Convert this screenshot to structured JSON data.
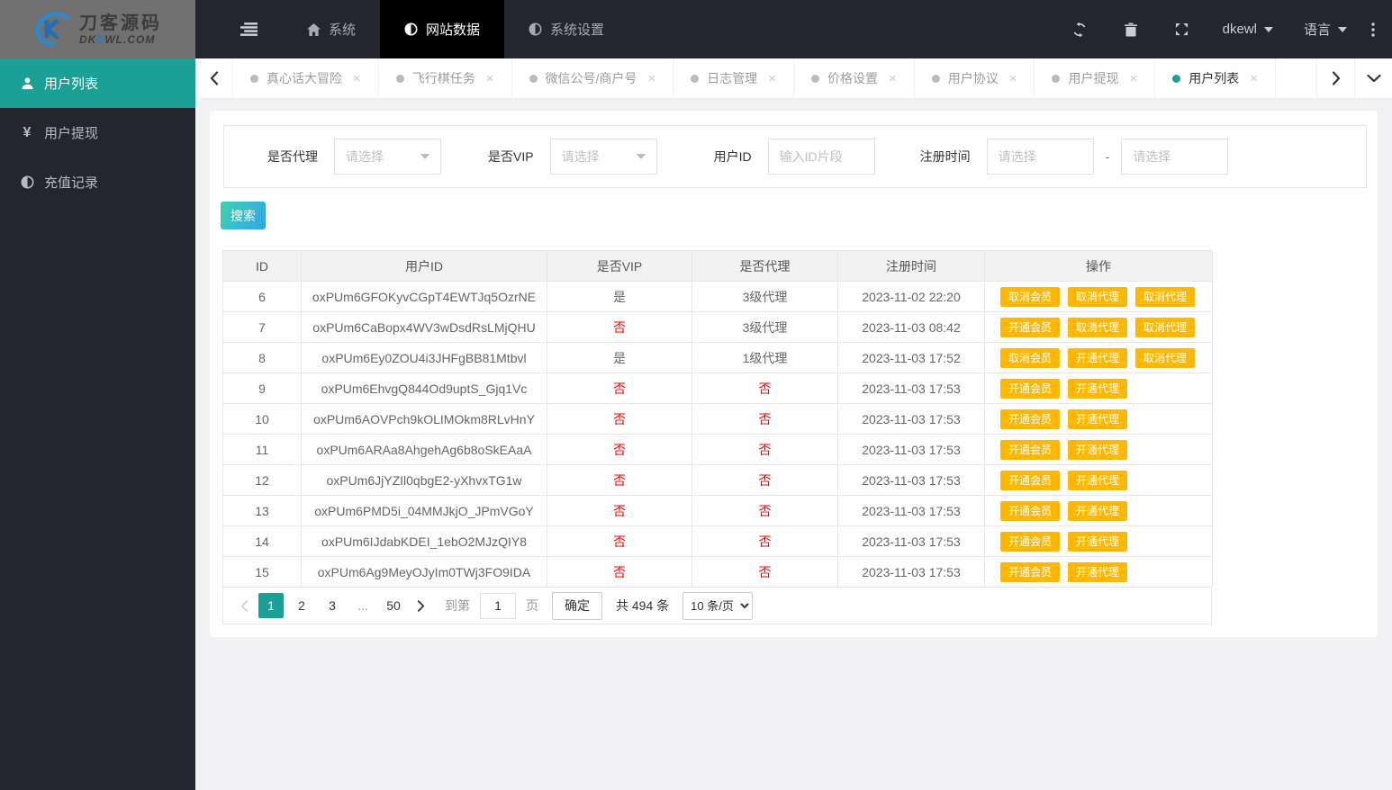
{
  "brand": {
    "title": "刀客源码",
    "sub_dk": "DK",
    "sub_e": "E",
    "sub_wl": "WL.COM"
  },
  "topnav": {
    "items": [
      {
        "label": "系统",
        "icon": "home-icon",
        "active": false
      },
      {
        "label": "网站数据",
        "icon": "half-circle-icon",
        "active": true
      },
      {
        "label": "系统设置",
        "icon": "half-circle-icon",
        "active": false
      }
    ],
    "user_label": "dkewl",
    "language_label": "语言"
  },
  "sidebar": {
    "items": [
      {
        "label": "用户列表",
        "icon": "user-icon",
        "active": true
      },
      {
        "label": "用户提现",
        "icon": "yen-icon",
        "active": false
      },
      {
        "label": "充值记录",
        "icon": "half-circle-icon",
        "active": false
      }
    ]
  },
  "tabbar": {
    "tabs": [
      {
        "label": "真心话大冒险",
        "active": false
      },
      {
        "label": "飞行棋任务",
        "active": false
      },
      {
        "label": "微信公号/商户号",
        "active": false
      },
      {
        "label": "日志管理",
        "active": false
      },
      {
        "label": "价格设置",
        "active": false
      },
      {
        "label": "用户协议",
        "active": false
      },
      {
        "label": "用户提现",
        "active": false
      },
      {
        "label": "用户列表",
        "active": true
      }
    ],
    "close_glyph": "×"
  },
  "filters": {
    "agent_label": "是否代理",
    "agent_placeholder": "请选择",
    "vip_label": "是否VIP",
    "vip_placeholder": "请选择",
    "user_id_label": "用户ID",
    "user_id_placeholder": "输入ID片段",
    "reg_time_label": "注册时间",
    "reg_start_placeholder": "请选择",
    "reg_end_placeholder": "请选择",
    "range_separator": "-"
  },
  "search_button_label": "搜索",
  "table": {
    "headers": [
      "ID",
      "用户ID",
      "是否VIP",
      "是否代理",
      "注册时间",
      "操作"
    ],
    "rows": [
      {
        "id": "6",
        "user_id": "oxPUm6GFOKyvCGpT4EWTJq5OzrNE",
        "vip": "是",
        "agent": "3级代理",
        "time": "2023-11-02 22:20",
        "actions": [
          "取消会员",
          "取消代理",
          "取消代理"
        ]
      },
      {
        "id": "7",
        "user_id": "oxPUm6CaBopx4WV3wDsdRsLMjQHU",
        "vip": "否",
        "agent": "3级代理",
        "time": "2023-11-03 08:42",
        "actions": [
          "开通会员",
          "取消代理",
          "取消代理"
        ]
      },
      {
        "id": "8",
        "user_id": "oxPUm6Ey0ZOU4i3JHFgBB81Mtbvl",
        "vip": "是",
        "agent": "1级代理",
        "time": "2023-11-03 17:52",
        "actions": [
          "取消会员",
          "开通代理",
          "取消代理"
        ]
      },
      {
        "id": "9",
        "user_id": "oxPUm6EhvgQ844Od9uptS_Gjq1Vc",
        "vip": "否",
        "agent": "否",
        "time": "2023-11-03 17:53",
        "actions": [
          "开通会员",
          "开通代理"
        ]
      },
      {
        "id": "10",
        "user_id": "oxPUm6AOVPch9kOLIMOkm8RLvHnY",
        "vip": "否",
        "agent": "否",
        "time": "2023-11-03 17:53",
        "actions": [
          "开通会员",
          "开通代理"
        ]
      },
      {
        "id": "11",
        "user_id": "oxPUm6ARAa8AhgehAg6b8oSkEAaA",
        "vip": "否",
        "agent": "否",
        "time": "2023-11-03 17:53",
        "actions": [
          "开通会员",
          "开通代理"
        ]
      },
      {
        "id": "12",
        "user_id": "oxPUm6JjYZIl0qbgE2-yXhvxTG1w",
        "vip": "否",
        "agent": "否",
        "time": "2023-11-03 17:53",
        "actions": [
          "开通会员",
          "开通代理"
        ]
      },
      {
        "id": "13",
        "user_id": "oxPUm6PMD5i_04MMJkjO_JPmVGoY",
        "vip": "否",
        "agent": "否",
        "time": "2023-11-03 17:53",
        "actions": [
          "开通会员",
          "开通代理"
        ]
      },
      {
        "id": "14",
        "user_id": "oxPUm6IJdabKDEI_1ebO2MJzQIY8",
        "vip": "否",
        "agent": "否",
        "time": "2023-11-03 17:53",
        "actions": [
          "开通会员",
          "开通代理"
        ]
      },
      {
        "id": "15",
        "user_id": "oxPUm6Ag9MeyOJyIm0TWj3FO9IDA",
        "vip": "否",
        "agent": "否",
        "time": "2023-11-03 17:53",
        "actions": [
          "开通会员",
          "开通代理"
        ]
      }
    ],
    "negative_value": "否"
  },
  "pagination": {
    "pages": [
      {
        "label": "1",
        "active": true
      },
      {
        "label": "2",
        "active": false
      },
      {
        "label": "3",
        "active": false
      },
      {
        "label": "...",
        "active": false,
        "ellipsis": true
      },
      {
        "label": "50",
        "active": false
      }
    ],
    "goto_label": "到第",
    "goto_value": "1",
    "page_unit_label": "页",
    "confirm_label": "确定",
    "total_label": "共 494 条",
    "per_page_selected": "10 条/页"
  },
  "colors": {
    "accent_teal": "#1AA094",
    "action_orange": "#FFB800",
    "danger_red": "#FF0000",
    "topbar_bg": "#23262E",
    "active_nav_bg": "#000000",
    "search_gradient_start": "#3FD3AE",
    "search_gradient_end": "#2EA6EA"
  }
}
